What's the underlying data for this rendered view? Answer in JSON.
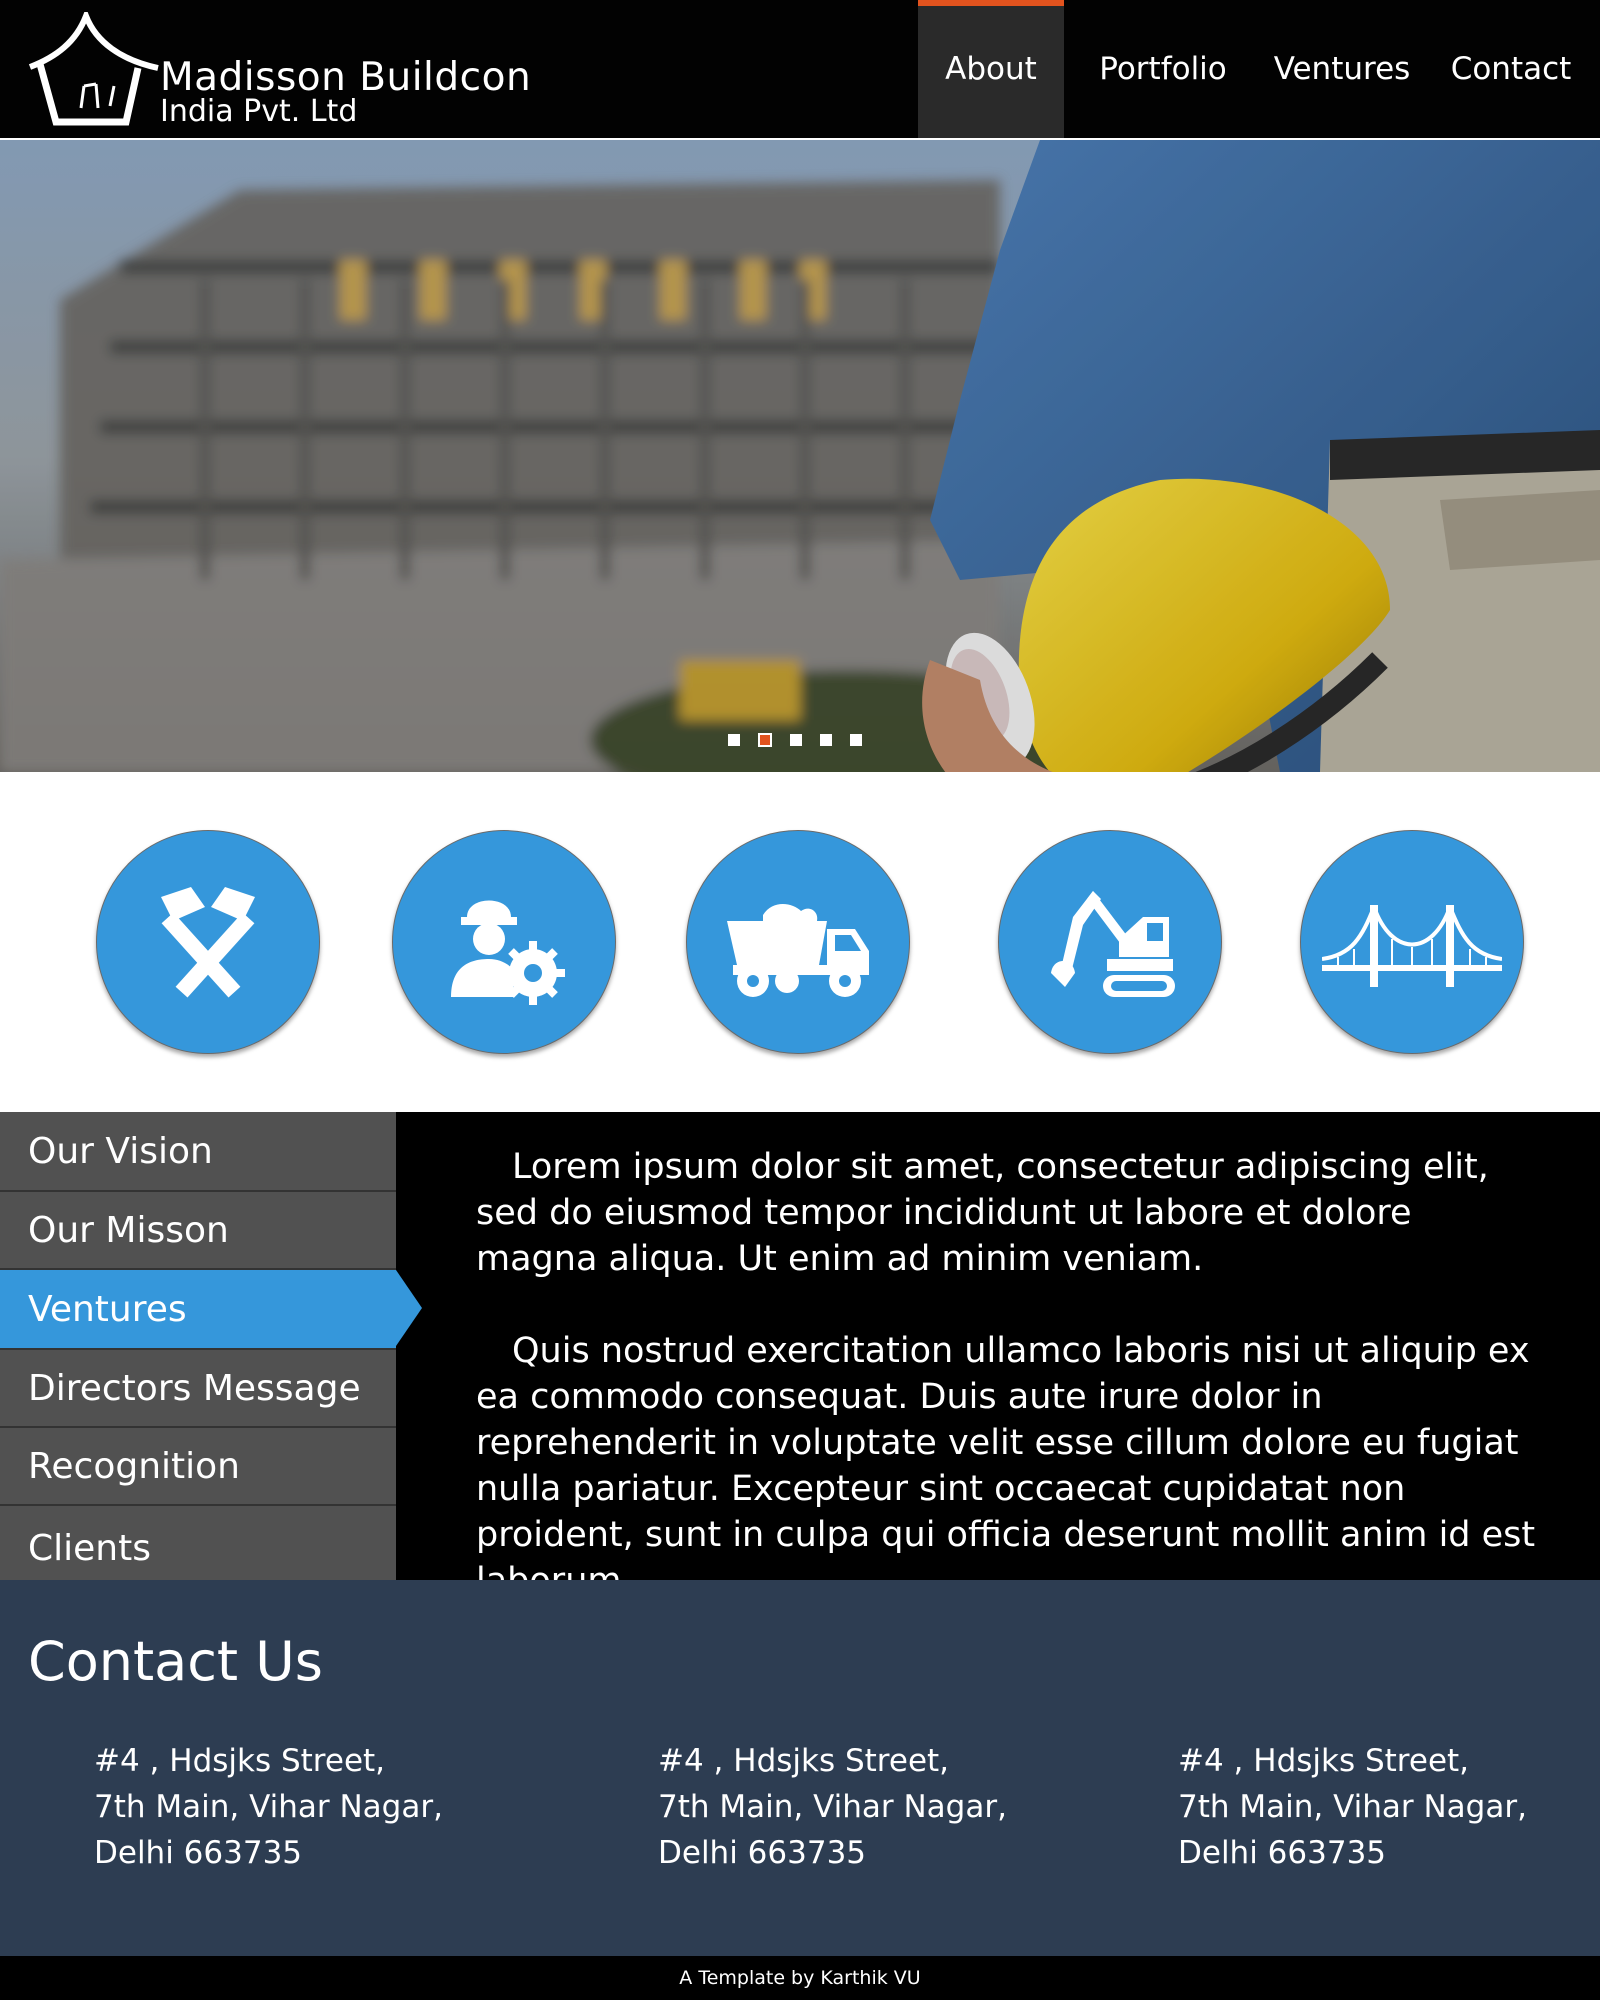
{
  "header": {
    "brand_name": "Madisson Buildcon",
    "brand_sub": "India Pvt. Ltd",
    "nav": [
      {
        "label": "About",
        "active": true
      },
      {
        "label": "Portfolio"
      },
      {
        "label": "Ventures"
      },
      {
        "label": "Contact"
      }
    ]
  },
  "hero": {
    "slides": 5,
    "active_slide": 2
  },
  "services": {
    "icons": [
      "hammers-icon",
      "engineer-gear-icon",
      "dump-truck-icon",
      "excavator-icon",
      "bridge-icon"
    ]
  },
  "sidebar": {
    "items": [
      {
        "label": "Our Vision"
      },
      {
        "label": "Our Misson"
      },
      {
        "label": "Ventures",
        "active": true
      },
      {
        "label": "Directors Message"
      },
      {
        "label": "Recognition"
      },
      {
        "label": "Clients"
      }
    ]
  },
  "content": {
    "paragraphs": [
      "Lorem ipsum dolor sit amet, consectetur adipiscing elit, sed do eiusmod tempor incididunt ut labore et dolore magna aliqua. Ut enim ad minim veniam.",
      "Quis nostrud exercitation ullamco laboris nisi ut aliquip ex ea commodo consequat. Duis aute irure dolor in reprehenderit in voluptate velit esse cillum dolore eu fugiat nulla pariatur. Excepteur sint occaecat cupidatat non proident, sunt in culpa qui officia deserunt mollit anim id est laborum."
    ]
  },
  "contact": {
    "title": "Contact Us",
    "addresses": [
      {
        "line1": "#4 , Hdsjks Street,",
        "line2": "7th Main, Vihar Nagar,",
        "line3": "Delhi 663735"
      },
      {
        "line1": "#4 , Hdsjks Street,",
        "line2": "7th Main, Vihar Nagar,",
        "line3": "Delhi 663735"
      },
      {
        "line1": "#4 , Hdsjks Street,",
        "line2": "7th Main, Vihar Nagar,",
        "line3": "Delhi 663735"
      }
    ]
  },
  "footer": {
    "text": "A Template by Karthik VU"
  },
  "colors": {
    "accent_orange": "#e2531e",
    "accent_blue": "#3597db",
    "contact_bg": "#2d3d52",
    "sidebar_bg": "#515151"
  }
}
